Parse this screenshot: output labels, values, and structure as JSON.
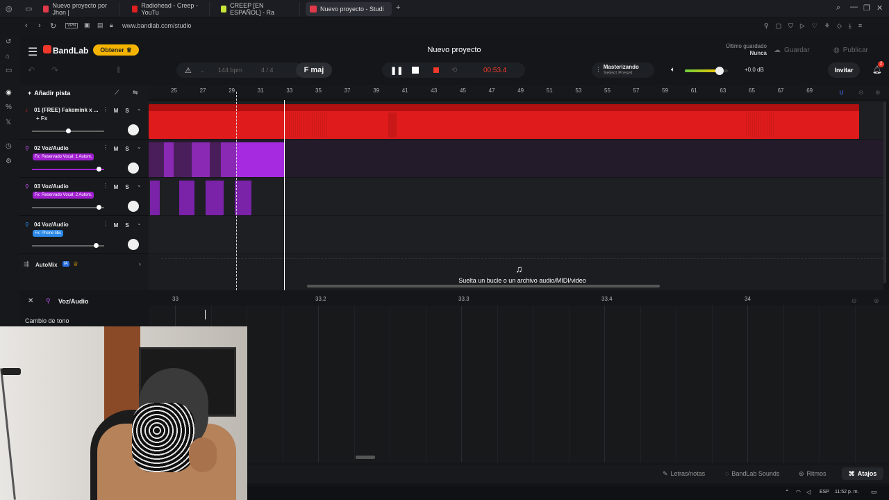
{
  "browser": {
    "tabs": [
      {
        "label": "Nuevo proyecto por Jhon |",
        "color": "#e0394a"
      },
      {
        "label": "Radiohead - Creep - YouTu",
        "color": "#e02020"
      },
      {
        "label": "CREEP [EN ESPAÑOL] - Ra",
        "color": "#c9e53a"
      },
      {
        "label": "Nuevo proyecto - Studi",
        "color": "#e0394a"
      }
    ],
    "vpn_badge": "VPN",
    "url": "www.bandlab.com/studio"
  },
  "app": {
    "brand": "BandLab",
    "get_button": "Obtener",
    "project_title": "Nuevo proyecto",
    "last_saved_label": "Último guardado",
    "last_saved_value": "Nunca",
    "save_button": "Guardar",
    "publish_button": "Publicar",
    "invite_button": "Invitar",
    "notification_count": "2",
    "accent": "#f0392b"
  },
  "transport": {
    "tempo": "144 bpm",
    "time_signature": "4 / 4",
    "key": "F maj",
    "time": "00:53.4",
    "mastering_title": "Masterizando",
    "mastering_preset": "Select Preset",
    "volume_db": "+0.0 dB",
    "volume_level": 0.8
  },
  "tracks_panel": {
    "add_track": "Añadir pista",
    "mute_label": "M",
    "solo_label": "S",
    "tracks": [
      {
        "name": "01  (FREE) Fakemink x ...",
        "fx": "+ Fx",
        "color": "#e02020",
        "vol": 0.5
      },
      {
        "name": "02  Voz/Audio",
        "fx": "Fx: Reservado Vocal: 1 Autom.",
        "color": "#a020d0",
        "vol": 0.92
      },
      {
        "name": "03  Voz/Audio",
        "fx": "Fx: Reservado Vocal: 2 Autom.",
        "color": "#a020d0",
        "vol": 0.92
      },
      {
        "name": "04  Voz/Audio",
        "fx": "Fx: Phone libs",
        "color": "#2b88e8",
        "vol": 0.88
      }
    ],
    "automix_label": "AutoMix",
    "automix_badge": "IA"
  },
  "ruler": {
    "marks": [
      "25",
      "27",
      "29",
      "31",
      "33",
      "35",
      "37",
      "39",
      "41",
      "43",
      "45",
      "47",
      "49",
      "51",
      "53",
      "55",
      "57",
      "59",
      "61",
      "63",
      "65",
      "67",
      "69"
    ]
  },
  "drop_zone": "Suelta un bucle o un archivo audio/MIDI/video",
  "editor": {
    "track_name": "Voz/Audio",
    "pitch_label": "Cambio de tono",
    "ruler_marks": [
      "33",
      "33.2",
      "33.3",
      "33.4",
      "34"
    ]
  },
  "footer": {
    "lyrics": "Letras/notas",
    "sounds": "BandLab Sounds",
    "rhythms": "Ritmos",
    "shortcuts": "Atajos"
  },
  "taskbar": {
    "lang": "ESP",
    "clock": "11:52 p. m."
  }
}
